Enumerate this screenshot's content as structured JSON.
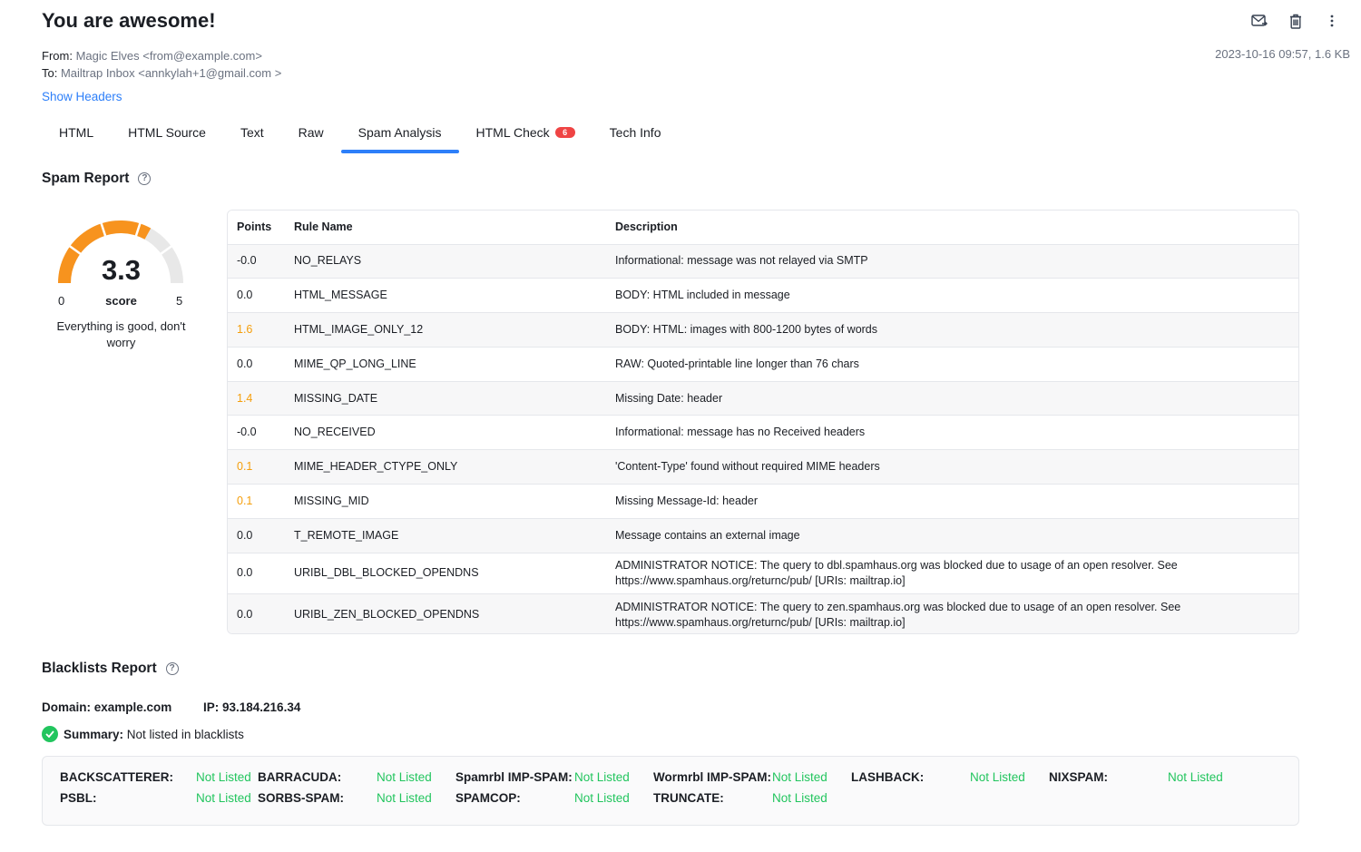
{
  "email": {
    "subject": "You are awesome!",
    "from_label": "From:",
    "from_value": "Magic Elves <from@example.com>",
    "to_label": "To:",
    "to_value": "Mailtrap Inbox <annkylah+1@gmail.com >",
    "date_size": "2023-10-16 09:57, 1.6 KB",
    "show_headers": "Show Headers"
  },
  "icons": {
    "forward": "forward-mail-icon",
    "delete": "trash-icon",
    "more": "more-vertical-icon"
  },
  "tabs": [
    {
      "label": "HTML"
    },
    {
      "label": "HTML Source"
    },
    {
      "label": "Text"
    },
    {
      "label": "Raw"
    },
    {
      "label": "Spam Analysis",
      "active": true
    },
    {
      "label": "HTML Check",
      "badge": "6"
    },
    {
      "label": "Tech Info"
    }
  ],
  "spam_report": {
    "title": "Spam Report",
    "score": "3.3",
    "score_value": 3.3,
    "score_max": 5,
    "min": "0",
    "max": "5",
    "score_label": "score",
    "message": "Everything is good, don't worry",
    "columns": [
      "Points",
      "Rule Name",
      "Description"
    ],
    "rows": [
      {
        "points": "-0.0",
        "rule": "NO_RELAYS",
        "desc": "Informational: message was not relayed via SMTP",
        "warn": false
      },
      {
        "points": "0.0",
        "rule": "HTML_MESSAGE",
        "desc": "BODY: HTML included in message",
        "warn": false
      },
      {
        "points": "1.6",
        "rule": "HTML_IMAGE_ONLY_12",
        "desc": "BODY: HTML: images with 800-1200 bytes of words",
        "warn": true
      },
      {
        "points": "0.0",
        "rule": "MIME_QP_LONG_LINE",
        "desc": "RAW: Quoted-printable line longer than 76 chars",
        "warn": false
      },
      {
        "points": "1.4",
        "rule": "MISSING_DATE",
        "desc": "Missing Date: header",
        "warn": true
      },
      {
        "points": "-0.0",
        "rule": "NO_RECEIVED",
        "desc": "Informational: message has no Received headers",
        "warn": false
      },
      {
        "points": "0.1",
        "rule": "MIME_HEADER_CTYPE_ONLY",
        "desc": "'Content-Type' found without required MIME headers",
        "warn": true
      },
      {
        "points": "0.1",
        "rule": "MISSING_MID",
        "desc": "Missing Message-Id: header",
        "warn": true
      },
      {
        "points": "0.0",
        "rule": "T_REMOTE_IMAGE",
        "desc": "Message contains an external image",
        "warn": false
      },
      {
        "points": "0.0",
        "rule": "URIBL_DBL_BLOCKED_OPENDNS",
        "desc": "ADMINISTRATOR NOTICE: The query to dbl.spamhaus.org was blocked due to usage of an open resolver. See https://www.spamhaus.org/returnc/pub/ [URIs: mailtrap.io]",
        "warn": false,
        "tall": true
      },
      {
        "points": "0.0",
        "rule": "URIBL_ZEN_BLOCKED_OPENDNS",
        "desc": "ADMINISTRATOR NOTICE: The query to zen.spamhaus.org was blocked due to usage of an open resolver. See https://www.spamhaus.org/returnc/pub/ [URIs: mailtrap.io]",
        "warn": false,
        "tall": true
      }
    ]
  },
  "blacklists": {
    "title": "Blacklists Report",
    "domain": "Domain: example.com",
    "ip": "IP: 93.184.216.34",
    "summary_label": "Summary:",
    "summary_value": "Not listed in blacklists",
    "items": [
      {
        "name": "BACKSCATTERER:",
        "status": "Not Listed"
      },
      {
        "name": "BARRACUDA:",
        "status": "Not Listed"
      },
      {
        "name": "Spamrbl IMP-SPAM:",
        "status": "Not Listed"
      },
      {
        "name": "Wormrbl IMP-SPAM:",
        "status": "Not Listed"
      },
      {
        "name": "LASHBACK:",
        "status": "Not Listed"
      },
      {
        "name": "NIXSPAM:",
        "status": "Not Listed"
      },
      {
        "name": "PSBL:",
        "status": "Not Listed"
      },
      {
        "name": "SORBS-SPAM:",
        "status": "Not Listed"
      },
      {
        "name": "SPAMCOP:",
        "status": "Not Listed"
      },
      {
        "name": "TRUNCATE:",
        "status": "Not Listed"
      }
    ]
  },
  "colors": {
    "accent": "#2d7ff9",
    "gauge_fill": "#f7931e",
    "gauge_track": "#e8e8e8",
    "warn": "#f59e0b",
    "ok": "#22c55e",
    "badge": "#ef4444"
  }
}
